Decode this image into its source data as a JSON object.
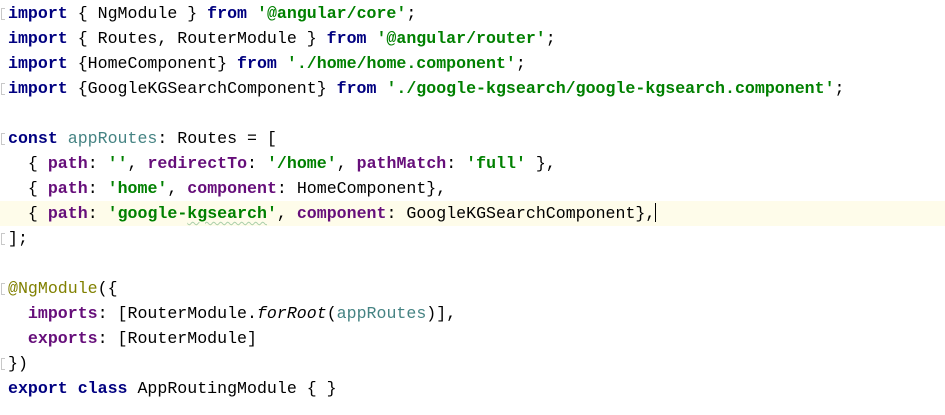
{
  "editor": {
    "lines": [
      {
        "tokens": [
          {
            "t": "import",
            "c": "kw"
          },
          {
            "t": " { NgModule } "
          },
          {
            "t": "from",
            "c": "kw"
          },
          {
            "t": " "
          },
          {
            "t": "'@angular/core'",
            "c": "str"
          },
          {
            "t": ";"
          }
        ]
      },
      {
        "tokens": [
          {
            "t": "import",
            "c": "kw"
          },
          {
            "t": " { Routes, RouterModule } "
          },
          {
            "t": "from",
            "c": "kw"
          },
          {
            "t": " "
          },
          {
            "t": "'@angular/router'",
            "c": "str"
          },
          {
            "t": ";"
          }
        ]
      },
      {
        "tokens": [
          {
            "t": "import",
            "c": "kw"
          },
          {
            "t": " {HomeComponent} "
          },
          {
            "t": "from",
            "c": "kw"
          },
          {
            "t": " "
          },
          {
            "t": "'./home/home.component'",
            "c": "str"
          },
          {
            "t": ";"
          }
        ]
      },
      {
        "tokens": [
          {
            "t": "import",
            "c": "kw"
          },
          {
            "t": " {GoogleKGSearchComponent} "
          },
          {
            "t": "from",
            "c": "kw"
          },
          {
            "t": " "
          },
          {
            "t": "'./google-kgsearch/google-kgsearch.component'",
            "c": "str"
          },
          {
            "t": ";"
          }
        ]
      },
      {
        "tokens": []
      },
      {
        "tokens": [
          {
            "t": "const",
            "c": "kw"
          },
          {
            "t": " "
          },
          {
            "t": "appRoutes",
            "c": "var"
          },
          {
            "t": ": Routes = ["
          }
        ]
      },
      {
        "tokens": [
          {
            "t": "  { "
          },
          {
            "t": "path",
            "c": "prop"
          },
          {
            "t": ": "
          },
          {
            "t": "''",
            "c": "str"
          },
          {
            "t": ", "
          },
          {
            "t": "redirectTo",
            "c": "prop"
          },
          {
            "t": ": "
          },
          {
            "t": "'/home'",
            "c": "str"
          },
          {
            "t": ", "
          },
          {
            "t": "pathMatch",
            "c": "prop"
          },
          {
            "t": ": "
          },
          {
            "t": "'full'",
            "c": "str"
          },
          {
            "t": " },"
          }
        ]
      },
      {
        "tokens": [
          {
            "t": "  { "
          },
          {
            "t": "path",
            "c": "prop"
          },
          {
            "t": ": "
          },
          {
            "t": "'home'",
            "c": "str"
          },
          {
            "t": ", "
          },
          {
            "t": "component",
            "c": "prop"
          },
          {
            "t": ": HomeComponent},"
          }
        ]
      },
      {
        "current": true,
        "caret": true,
        "tokens": [
          {
            "t": "  { "
          },
          {
            "t": "path",
            "c": "prop"
          },
          {
            "t": ": "
          },
          {
            "t": "'google-",
            "c": "str"
          },
          {
            "t": "kgsearch",
            "c": "str squiggle"
          },
          {
            "t": "'",
            "c": "str"
          },
          {
            "t": ", "
          },
          {
            "t": "component",
            "c": "prop"
          },
          {
            "t": ": GoogleKGSearchComponent},"
          }
        ]
      },
      {
        "tokens": [
          {
            "t": "];"
          }
        ]
      },
      {
        "tokens": []
      },
      {
        "tokens": [
          {
            "t": "@NgModule",
            "c": "dec"
          },
          {
            "t": "({"
          }
        ]
      },
      {
        "tokens": [
          {
            "t": "  "
          },
          {
            "t": "imports",
            "c": "prop"
          },
          {
            "t": ": [RouterModule."
          },
          {
            "t": "forRoot",
            "c": "ital"
          },
          {
            "t": "("
          },
          {
            "t": "appRoutes",
            "c": "var"
          },
          {
            "t": ")],"
          }
        ]
      },
      {
        "tokens": [
          {
            "t": "  "
          },
          {
            "t": "exports",
            "c": "prop"
          },
          {
            "t": ": [RouterModule]"
          }
        ]
      },
      {
        "tokens": [
          {
            "t": "})"
          }
        ]
      },
      {
        "tokens": [
          {
            "t": "export",
            "c": "kw"
          },
          {
            "t": " "
          },
          {
            "t": "class",
            "c": "kw"
          },
          {
            "t": " AppRoutingModule { }"
          }
        ]
      }
    ]
  }
}
